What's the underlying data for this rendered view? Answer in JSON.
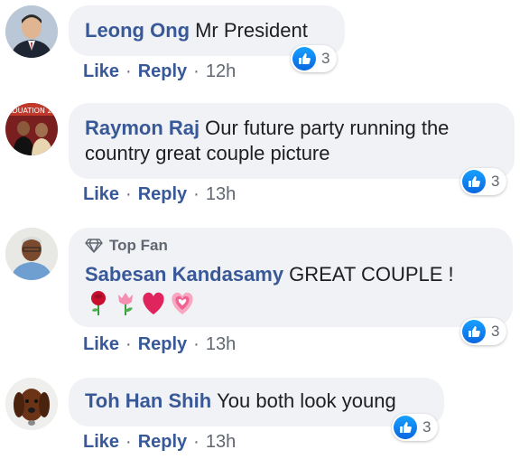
{
  "comments": [
    {
      "author": "Leong Ong",
      "text": "Mr President",
      "actions": {
        "like": "Like",
        "reply": "Reply",
        "time": "12h"
      },
      "reaction_count": "3"
    },
    {
      "author": "Raymon Raj",
      "text": "Our future party running the",
      "text_line2": "country great couple picture",
      "actions": {
        "like": "Like",
        "reply": "Reply",
        "time": "13h"
      },
      "reaction_count": "3"
    },
    {
      "badge": "Top Fan",
      "author": "Sabesan Kandasamy",
      "text": "GREAT COUPLE !",
      "emojis": [
        "rose",
        "tulip",
        "red-heart",
        "growing-heart"
      ],
      "actions": {
        "like": "Like",
        "reply": "Reply",
        "time": "13h"
      },
      "reaction_count": "3"
    },
    {
      "author": "Toh Han Shih",
      "text": "You both look young",
      "actions": {
        "like": "Like",
        "reply": "Reply",
        "time": "13h"
      },
      "reaction_count": "3"
    }
  ],
  "separator": "·",
  "colors": {
    "name": "#385898",
    "bubble": "#f0f2f5",
    "meta": "#606770",
    "like": "#1877f2"
  }
}
